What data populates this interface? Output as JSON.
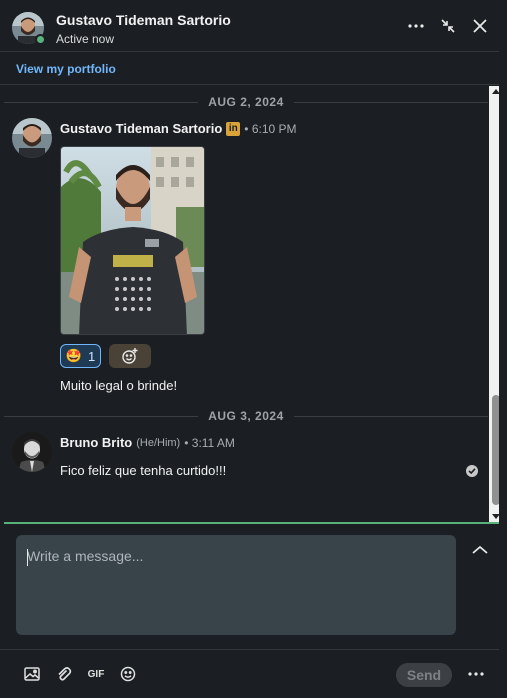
{
  "header": {
    "name": "Gustavo Tideman Sartorio",
    "status": "Active now",
    "icons": [
      "more-horizontal-icon",
      "minimize-icon",
      "close-icon"
    ]
  },
  "portfolio": {
    "link_label": "View my portfolio"
  },
  "background_hint": "livro",
  "conversation": {
    "groups": [
      {
        "date": "AUG 2, 2024",
        "sender": "Gustavo Tideman Sartorio",
        "badge": "in",
        "time": "6:10 PM",
        "reaction": {
          "emoji": "🤩",
          "count": "1"
        },
        "text": "Muito legal o brinde!"
      },
      {
        "date": "AUG 3, 2024",
        "sender": "Bruno Brito",
        "pronouns": "(He/Him)",
        "time": "3:11 AM",
        "text": "Fico feliz que tenha curtido!!!"
      }
    ]
  },
  "compose": {
    "placeholder": "Write a message...",
    "gif_label": "GIF",
    "send_label": "Send"
  },
  "colors": {
    "background": "#1b1f23",
    "link": "#71b7fb",
    "online": "#57b27b",
    "linkedin_badge": "#d9a33a",
    "input": "#38434a"
  }
}
